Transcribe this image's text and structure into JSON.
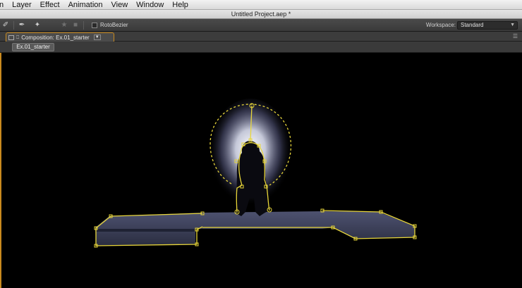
{
  "menubar": {
    "items": [
      "n",
      "Layer",
      "Effect",
      "Animation",
      "View",
      "Window",
      "Help"
    ]
  },
  "window": {
    "title": "Untitled Project.aep *"
  },
  "toolbar": {
    "rotobezier_label": "RotoBezier",
    "workspace_label": "Workspace:",
    "workspace_value": "Standard",
    "icons": [
      "pen-icon",
      "brush-icon",
      "puppet-icon",
      "star-icon",
      "square-icon"
    ]
  },
  "panel": {
    "tab_label": "Composition: Ex.01_starter"
  },
  "composition": {
    "button_label": "Ex.01_starter"
  },
  "colors": {
    "accent": "#c98a1e",
    "mask_stroke": "#e8d63a",
    "glow": "#e8ecff"
  }
}
